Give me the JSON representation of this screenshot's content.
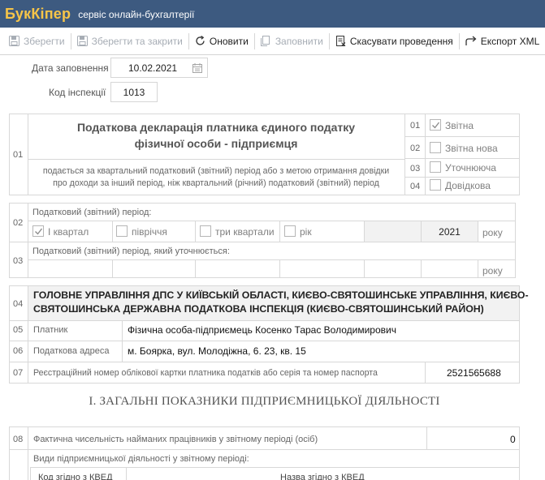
{
  "app": {
    "brand": "БукКіпер",
    "tagline": "сервіс онлайн-бухгалтерії"
  },
  "toolbar": {
    "save": "Зберегти",
    "save_close": "Зберегти та закрити",
    "refresh": "Оновити",
    "fill": "Заповнити",
    "cancel_posting": "Скасувати проведення",
    "export_xml": "Експорт XML"
  },
  "header": {
    "date_label": "Дата заповнення",
    "date_value": "10.02.2021",
    "inspection_label": "Код інспекції",
    "inspection_value": "1013"
  },
  "decl": {
    "row_num": "01",
    "title_line1": "Податкова декларація платника єдиного податку",
    "title_line2": "фізичної особи - підприємця",
    "note_line1": "подається за квартальний податковий (звітний) період або з метою отримання довідки",
    "note_line2": "про доходи за інший період, ніж квартальний (річний) податковий (звітний) період",
    "types": [
      {
        "num": "01",
        "label": "Звітна",
        "checked": true
      },
      {
        "num": "02",
        "label": "Звітна нова",
        "checked": false
      },
      {
        "num": "03",
        "label": "Уточнююча",
        "checked": false
      },
      {
        "num": "04",
        "label": "Довідкова",
        "checked": false
      }
    ]
  },
  "period": {
    "row_num": "02",
    "title": "Податковий (звітний) період:",
    "options": [
      {
        "label": "І квартал",
        "checked": true
      },
      {
        "label": "півріччя",
        "checked": false
      },
      {
        "label": "три квартали",
        "checked": false
      },
      {
        "label": "рік",
        "checked": false
      }
    ],
    "year": "2021",
    "year_suffix": "року"
  },
  "period_corr": {
    "row_num": "03",
    "title": "Податковий (звітний) період, який уточнюється:",
    "year_suffix": "року"
  },
  "authority": {
    "row_num": "04",
    "line1": "ГОЛОВНЕ УПРАВЛІННЯ ДПС У КИЇВСЬКІЙ ОБЛАСТІ, КИЄВО-СВЯТОШИНСЬКЕ УПРАВЛІННЯ, КИЄВО-",
    "line2": "СВЯТОШИНСЬКА  ДЕРЖАВНА ПОДАТКОВА ІНСПЕКЦІЯ (КИЄВО-СВЯТОШИНСЬКИЙ РАЙОН)"
  },
  "payer": {
    "row_num": "05",
    "label": "Платник",
    "value": "Фізична особа-підприємець Косенко Тарас Володимирович"
  },
  "address": {
    "row_num": "06",
    "label": "Податкова адреса",
    "value": "м. Боярка, вул. Молодіжна, 6. 23, кв. 15"
  },
  "regnum": {
    "row_num": "07",
    "label": "Реєстраційний номер облікової картки платника податків або серія та номер паспорта",
    "value": "2521565688"
  },
  "section1": {
    "title": "І. ЗАГАЛЬНІ ПОКАЗНИКИ ПІДПРИЄМНИЦЬКОЇ ДІЯЛЬНОСТІ"
  },
  "employees": {
    "row_num": "08",
    "label": "Фактична чисельність найманих працівників у звітному періоді (осіб)",
    "value": "0"
  },
  "activities": {
    "title": "Види підприємницької діяльності у звітному періоді:",
    "col_code": "Код згідно з КВЕД",
    "col_name": "Назва згідно з КВЕД"
  }
}
